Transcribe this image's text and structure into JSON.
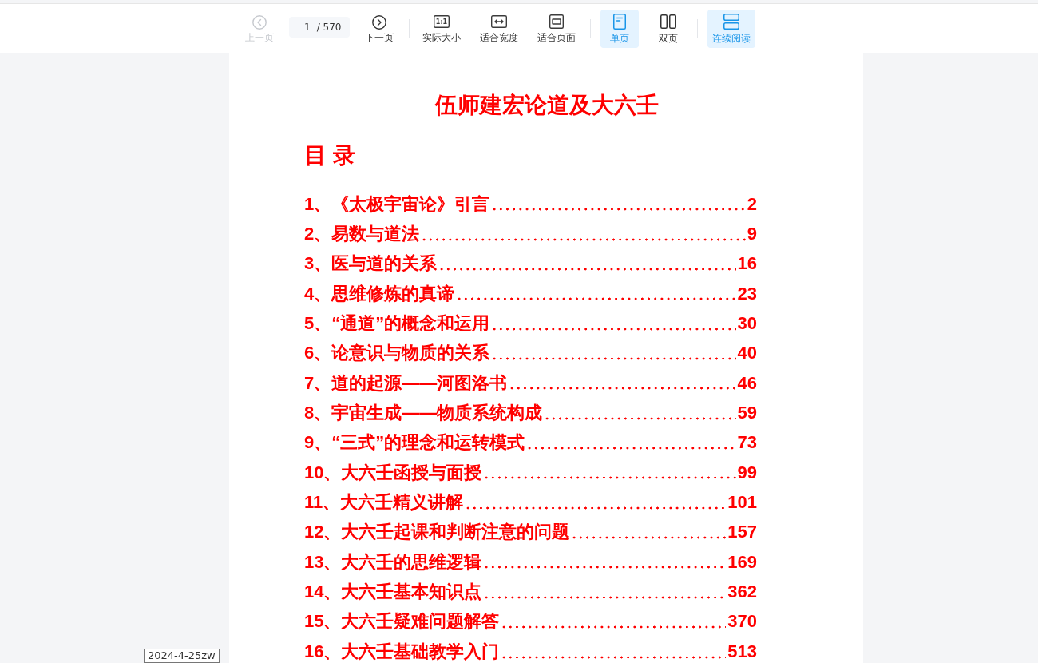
{
  "toolbar": {
    "prev_button": {
      "label": "上一页",
      "disabled": true
    },
    "page_field": {
      "value": "1",
      "total": "/ 570"
    },
    "next_button": {
      "label": "下一页",
      "disabled": false
    },
    "zoom_buttons": [
      {
        "kind": "actual_size",
        "label": "实际大小",
        "icon_text": "1:1"
      },
      {
        "kind": "fit_width",
        "label": "适合宽度"
      },
      {
        "kind": "fit_page",
        "label": "适合页面"
      }
    ],
    "layout_buttons": [
      {
        "kind": "single",
        "label": "单页",
        "selected": true
      },
      {
        "kind": "double",
        "label": "双页",
        "selected": false
      }
    ],
    "continuous_button": {
      "label": "连续阅读",
      "on": true
    }
  },
  "document": {
    "title": "伍师建宏论道及大六壬",
    "toc_heading": "目 录",
    "entries": [
      {
        "title": "1、《太极宇宙论》引言",
        "page": "2"
      },
      {
        "title": "2、易数与道法",
        "page": "9"
      },
      {
        "title": "3、医与道的关系",
        "page": "16"
      },
      {
        "title": "4、思维修炼的真谛",
        "page": "23"
      },
      {
        "title": "5、“通道”的概念和运用",
        "page": "30"
      },
      {
        "title": "6、论意识与物质的关系",
        "page": "40"
      },
      {
        "title": "7、道的起源——河图洛书",
        "page": "46"
      },
      {
        "title": "8、宇宙生成——物质系统构成",
        "page": "59"
      },
      {
        "title": "9、“三式”的理念和运转模式",
        "page": "73"
      },
      {
        "title": "10、大六壬函授与面授",
        "page": "99"
      },
      {
        "title": "11、大六壬精义讲解",
        "page": "101"
      },
      {
        "title": "12、大六壬起课和判断注意的问题",
        "page": "157"
      },
      {
        "title": "13、大六壬的思维逻辑",
        "page": "169"
      },
      {
        "title": "14、大六壬基本知识点",
        "page": "362"
      },
      {
        "title": "15、大六壬疑难问题解答",
        "page": "370"
      },
      {
        "title": "16、大六壬基础教学入门",
        "page": "513"
      }
    ]
  },
  "tooltip": {
    "text": "2024-4-25zw"
  }
}
